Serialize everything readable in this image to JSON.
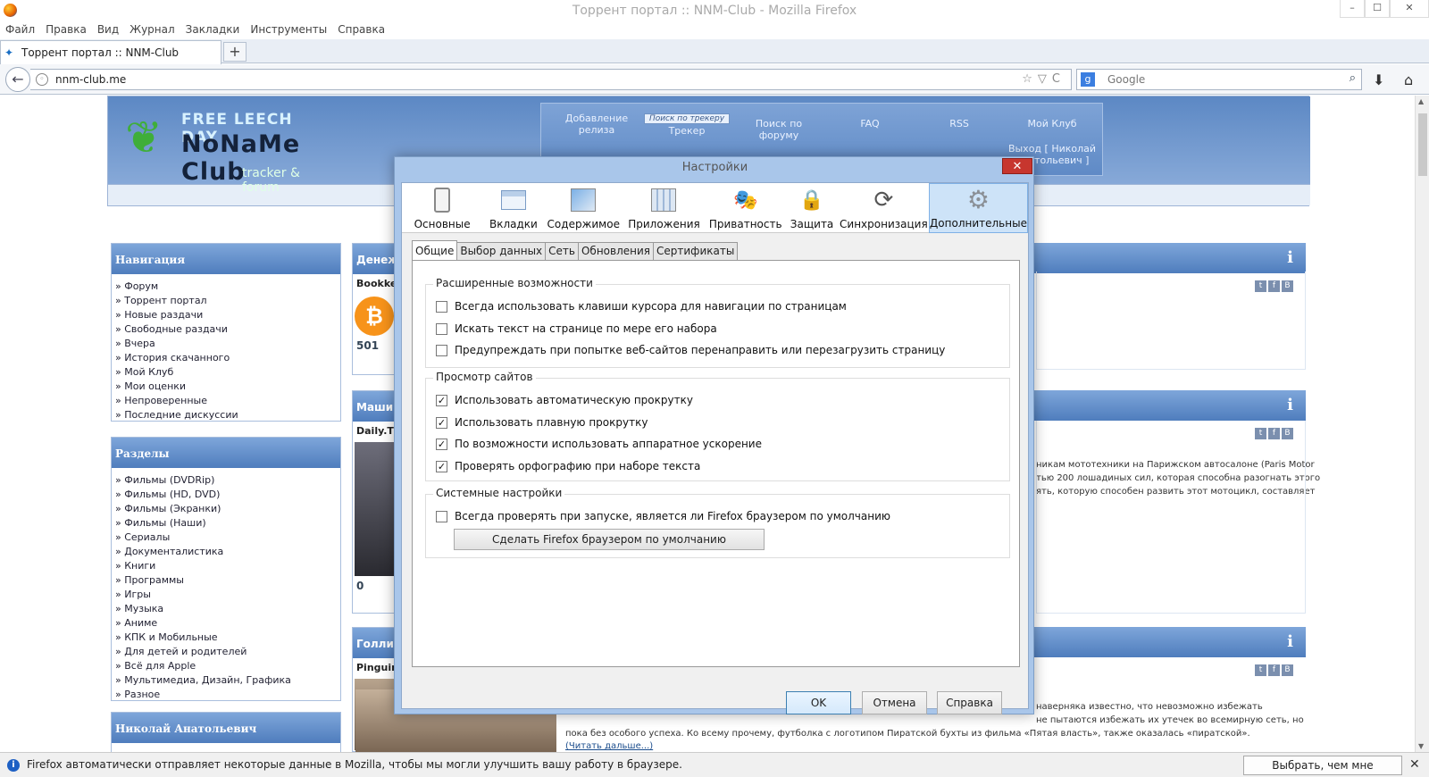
{
  "window": {
    "title": "Торрент портал :: NNM-Club - Mozilla Firefox",
    "min": "–",
    "max": "☐",
    "close": "✕"
  },
  "menu": [
    "Файл",
    "Правка",
    "Вид",
    "Журнал",
    "Закладки",
    "Инструменты",
    "Справка"
  ],
  "tab": {
    "label": "Торрент портал :: NNM-Club",
    "new_tab": "+"
  },
  "nav": {
    "url": "nnm-club.me",
    "search_placeholder": "Google",
    "search_engine": "g",
    "url_right_icons": "☆▽C"
  },
  "site": {
    "logo_top": "FREE LEECH DAY",
    "logo_main": "NoNaMe Club",
    "logo_sub": "tracker & forum",
    "topnav": [
      {
        "label": "Добавление релиза"
      },
      {
        "label": "Поиск по трекеру"
      },
      {
        "label": "Трекер"
      },
      {
        "label": "Поиск по форуму"
      },
      {
        "label": "FAQ"
      },
      {
        "label": "RSS"
      },
      {
        "label": "Мой Клуб"
      },
      {
        "label": "Выход [ Николай Анатольевич ]"
      }
    ],
    "nav_box": {
      "title": "Навигация",
      "items": [
        "» Форум",
        "» Торрент портал",
        "» Новые раздачи",
        "» Свободные раздачи",
        "» Вчера",
        "» История скачанного",
        "» Мой Клуб",
        "» Мои оценки",
        "» Непроверенные",
        "» Последние дискуссии"
      ]
    },
    "sections_box": {
      "title": "Разделы",
      "items": [
        "» Фильмы (DVDRip)",
        "» Фильмы (HD, DVD)",
        "» Фильмы (Экранки)",
        "» Фильмы (Наши)",
        "» Сериалы",
        "» Документалистика",
        "» Книги",
        "» Программы",
        "» Игры",
        "» Музыка",
        "» Аниме",
        "» КПК и Мобильные",
        "» Для детей и родителей",
        "» Всё для Apple",
        "» Мультимедиа, Дизайн, Графика",
        "» Разное"
      ]
    },
    "user_box": {
      "title": "Николай Анатольевич"
    },
    "mid": [
      {
        "title": "Денеж",
        "sub": "Bookke",
        "count": "501"
      },
      {
        "title": "Маши",
        "sub": "Daily.T",
        "count": "0"
      },
      {
        "title": "Голли",
        "sub": "Pinguir"
      }
    ],
    "right_text_1": [
      "никам мототехники на Парижском автосалоне (Paris Motor",
      "тью 200 лошадиных сил, которая способна разогнать этого",
      "ять, которую способен развить этот мотоцикл, составляет"
    ],
    "right_text_3": [
      "наверняка известно, что невозможно избежать",
      "не пытаются избежать их утечек во всемирную сеть, но",
      "пока без особого успеха. Ко всему прочему, футболка с логотипом Пиратской бухты из фильма «Пятая власть», также оказалась «пиратской».",
      "(Читать дальше...)"
    ],
    "social": [
      "t",
      "f",
      "B"
    ],
    "info_icon": "i"
  },
  "dialog": {
    "title": "Настройки",
    "close": "✕",
    "panes": [
      {
        "label": "Основные",
        "icon": "phone-icon"
      },
      {
        "label": "Вкладки",
        "icon": "tabs-icon"
      },
      {
        "label": "Содержимое",
        "icon": "content-icon"
      },
      {
        "label": "Приложения",
        "icon": "apps-icon"
      },
      {
        "label": "Приватность",
        "icon": "mask-icon"
      },
      {
        "label": "Защита",
        "icon": "lock-icon"
      },
      {
        "label": "Синхронизация",
        "icon": "sync-icon"
      },
      {
        "label": "Дополнительные",
        "icon": "gear-icon",
        "selected": true
      }
    ],
    "subtabs": [
      "Общие",
      "Выбор данных",
      "Сеть",
      "Обновления",
      "Сертификаты"
    ],
    "groups": [
      {
        "label": "Расширенные возможности",
        "options": [
          {
            "label": "Всегда использовать клавиши курсора для навигации по страницам",
            "checked": false
          },
          {
            "label": "Искать текст на странице по мере его набора",
            "checked": false
          },
          {
            "label": "Предупреждать при попытке веб-сайтов перенаправить или перезагрузить страницу",
            "checked": false
          }
        ]
      },
      {
        "label": "Просмотр сайтов",
        "options": [
          {
            "label": "Использовать автоматическую прокрутку",
            "checked": true
          },
          {
            "label": "Использовать плавную прокрутку",
            "checked": true
          },
          {
            "label": "По возможности использовать аппаратное ускорение",
            "checked": true
          },
          {
            "label": "Проверять орфографию при наборе текста",
            "checked": true
          }
        ]
      },
      {
        "label": "Системные настройки",
        "options": [
          {
            "label": "Всегда проверять при запуске, является ли Firefox браузером по умолчанию",
            "checked": false
          }
        ],
        "button": "Сделать Firefox браузером по умолчанию"
      }
    ],
    "buttons": {
      "ok": "OK",
      "cancel": "Отмена",
      "help": "Справка"
    },
    "check_mark": "✓"
  },
  "notification": {
    "message": "Firefox автоматически отправляет некоторые данные в Mozilla, чтобы мы могли улучшить вашу работу в браузере.",
    "button": "Выбрать, чем мне поделиться",
    "close": "✕",
    "icon": "i"
  }
}
